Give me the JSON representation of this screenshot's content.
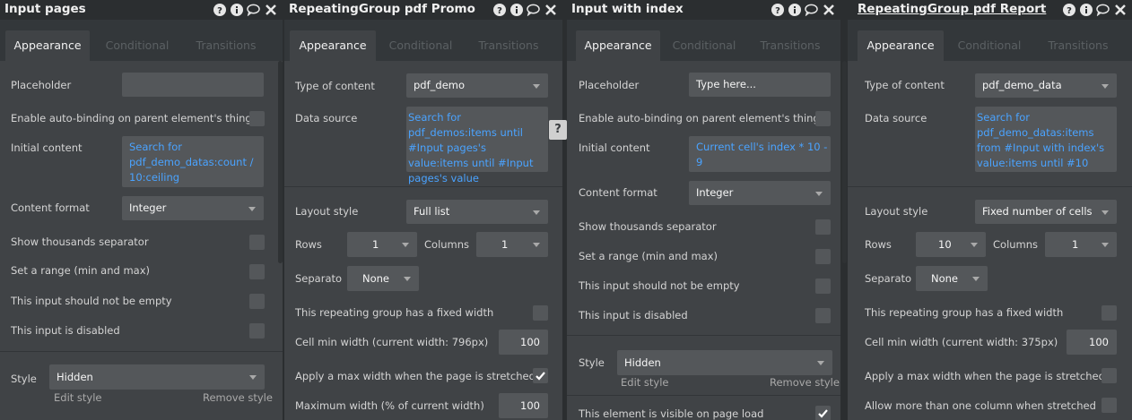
{
  "panels": [
    {
      "title": "Input pages",
      "tabs": [
        "Appearance",
        "Conditional",
        "Transitions"
      ],
      "placeholder_label": "Placeholder",
      "placeholder_value": "",
      "autobind_label": "Enable auto-binding on parent element's thing",
      "initial_content_label": "Initial content",
      "initial_content_value": "Search for pdf_demo_datas:count / 10:ceiling",
      "content_format_label": "Content format",
      "content_format_value": "Integer",
      "thousands_label": "Show thousands separator",
      "range_label": "Set a range (min and max)",
      "not_empty_label": "This input should not be empty",
      "disabled_label": "This input is disabled",
      "style_label": "Style",
      "style_value": "Hidden",
      "edit_style": "Edit style",
      "remove_style": "Remove style"
    },
    {
      "title": "RepeatingGroup pdf Promo",
      "tabs": [
        "Appearance",
        "Conditional",
        "Transitions"
      ],
      "type_label": "Type of content",
      "type_value": "pdf_demo",
      "source_label": "Data source",
      "source_value": "Search for pdf_demos:items until #Input pages's value:items until #Input pages's value",
      "layout_label": "Layout style",
      "layout_value": "Full list",
      "rows_label": "Rows",
      "rows_value": "1",
      "columns_label": "Columns",
      "columns_value": "1",
      "separator_label": "Separato",
      "separator_value": "None",
      "fixed_width_label": "This repeating group has a fixed width",
      "cell_min_label": "Cell min width (current width: 796px)",
      "cell_min_value": "100",
      "max_width_label": "Apply a max width when the page is stretched",
      "max_pct_label": "Maximum width (% of current width)",
      "max_pct_value": "100"
    },
    {
      "title": "Input with index",
      "tabs": [
        "Appearance",
        "Conditional",
        "Transitions"
      ],
      "placeholder_label": "Placeholder",
      "placeholder_value": "Type here...",
      "autobind_label": "Enable auto-binding on parent element's thing",
      "initial_content_label": "Initial content",
      "initial_content_value": "Current cell's index * 10 - 9",
      "content_format_label": "Content format",
      "content_format_value": "Integer",
      "thousands_label": "Show thousands separator",
      "range_label": "Set a range (min and max)",
      "not_empty_label": "This input should not be empty",
      "disabled_label": "This input is disabled",
      "style_label": "Style",
      "style_value": "Hidden",
      "edit_style": "Edit style",
      "remove_style": "Remove style",
      "visible_label": "This element is visible on page load"
    },
    {
      "title": "RepeatingGroup pdf Report",
      "tabs": [
        "Appearance",
        "Conditional",
        "Transitions"
      ],
      "type_label": "Type of content",
      "type_value": "pdf_demo_data",
      "source_label": "Data source",
      "source_value": "Search for pdf_demo_datas:items from #Input with index's value:items until #10",
      "layout_label": "Layout style",
      "layout_value": "Fixed number of cells",
      "rows_label": "Rows",
      "rows_value": "10",
      "columns_label": "Columns",
      "columns_value": "1",
      "separator_label": "Separato",
      "separator_value": "None",
      "fixed_width_label": "This repeating group has a fixed width",
      "cell_min_label": "Cell min width (current width: 375px)",
      "cell_min_value": "100",
      "max_width_label": "Apply a max width when the page is stretched",
      "multi_col_label": "Allow more than one column when stretched"
    }
  ],
  "help_glyph": "?",
  "icons": [
    "help-circle-icon",
    "info-circle-icon",
    "comment-icon",
    "close-icon"
  ]
}
